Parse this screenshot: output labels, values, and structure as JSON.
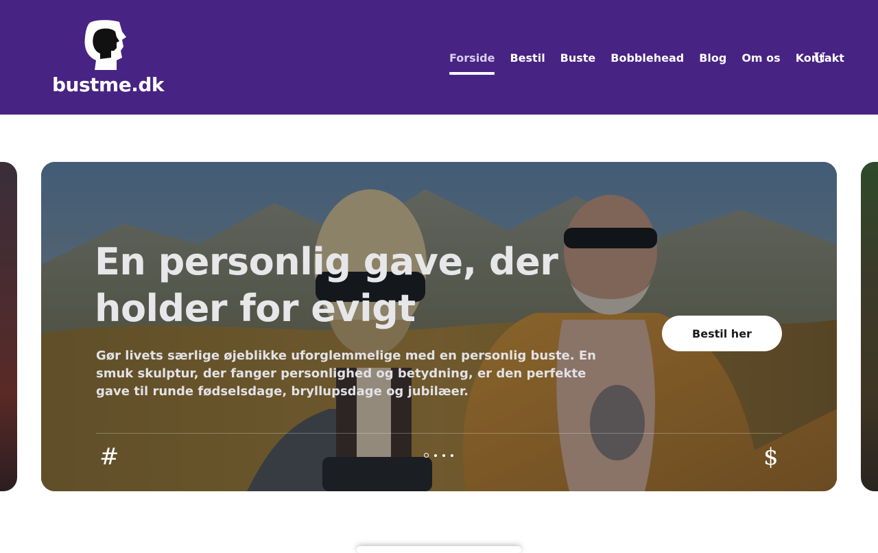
{
  "brand": {
    "name": "bustme.dk"
  },
  "nav": {
    "items": [
      {
        "label": "Forside"
      },
      {
        "label": "Bestil"
      },
      {
        "label": "Buste"
      },
      {
        "label": "Bobblehead"
      },
      {
        "label": "Blog"
      },
      {
        "label": "Om os"
      },
      {
        "label": "Kontakt"
      }
    ],
    "active_item": "Forside",
    "extra_icon_glyph": "U",
    "extra_icon": "user-icon"
  },
  "hero": {
    "title": "En personlig gave, der holder for evigt",
    "text": "Gør livets særlige øjeblikke uforglemmelige med en personlig buste. En smuk skulptur, der fanger personlighed og betydning, er den perfekte gave til runde fødselsdage, bryllupsdage og jubilæer.",
    "cta_label": "Bestil her",
    "prev_glyph": "#",
    "next_glyph": "$",
    "slide_count": 4,
    "active_slide": 1
  },
  "colors": {
    "header_bg": "#472383",
    "text_on_dark": "#ffffff",
    "cta_bg": "#ffffff",
    "cta_text": "#1a1a1a"
  }
}
